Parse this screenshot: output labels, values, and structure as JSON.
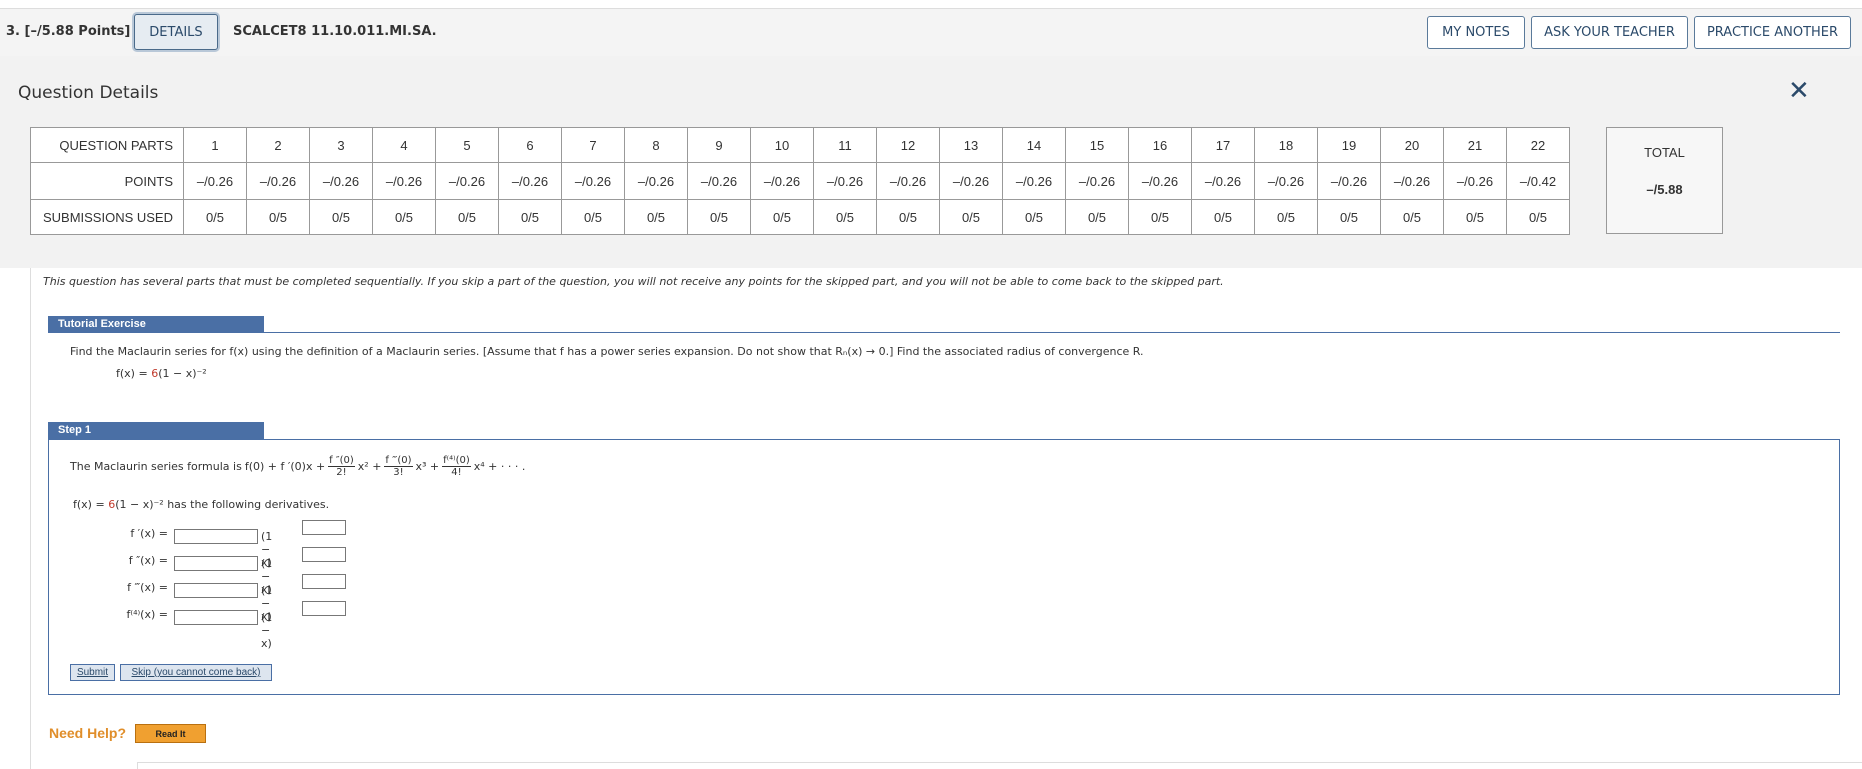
{
  "header": {
    "question_number": "3. [–/5.88 Points]",
    "details_label": "DETAILS",
    "question_code": "SCALCET8 11.10.011.MI.SA.",
    "my_notes_label": "MY NOTES",
    "ask_teacher_label": "ASK YOUR TEACHER",
    "practice_label": "PRACTICE ANOTHER"
  },
  "details": {
    "title": "Question Details",
    "close_symbol": "✕",
    "row_labels": [
      "QUESTION PARTS",
      "POINTS",
      "SUBMISSIONS USED"
    ],
    "parts": [
      "1",
      "2",
      "3",
      "4",
      "5",
      "6",
      "7",
      "8",
      "9",
      "10",
      "11",
      "12",
      "13",
      "14",
      "15",
      "16",
      "17",
      "18",
      "19",
      "20",
      "21",
      "22"
    ],
    "points": [
      "–/0.26",
      "–/0.26",
      "–/0.26",
      "–/0.26",
      "–/0.26",
      "–/0.26",
      "–/0.26",
      "–/0.26",
      "–/0.26",
      "–/0.26",
      "–/0.26",
      "–/0.26",
      "–/0.26",
      "–/0.26",
      "–/0.26",
      "–/0.26",
      "–/0.26",
      "–/0.26",
      "–/0.26",
      "–/0.26",
      "–/0.26",
      "–/0.42"
    ],
    "submissions": [
      "0/5",
      "0/5",
      "0/5",
      "0/5",
      "0/5",
      "0/5",
      "0/5",
      "0/5",
      "0/5",
      "0/5",
      "0/5",
      "0/5",
      "0/5",
      "0/5",
      "0/5",
      "0/5",
      "0/5",
      "0/5",
      "0/5",
      "0/5",
      "0/5",
      "0/5"
    ],
    "total_label": "TOTAL",
    "total_value": "–/5.88"
  },
  "content": {
    "sequential_note": "This question has several parts that must be completed sequentially. If you skip a part of the question, you will not receive any points for the skipped part, and you will not be able to come back to the skipped part.",
    "tutorial_label": "Tutorial Exercise",
    "instructions": "Find the Maclaurin series for f(x) using the definition of a Maclaurin series. [Assume that f has a power series expansion. Do not show that Rₙ(x) → 0.] Find the associated radius of convergence R.",
    "function_lhs": "f(x) = ",
    "function_coef": "6",
    "function_rhs": "(1 − x)⁻²",
    "step_label": "Step 1",
    "formula_intro": "The Maclaurin series formula is",
    "formula_start": "f(0) + f ′(0)x +",
    "formula_t2_num": "f ″(0)",
    "formula_t2_den": "2!",
    "formula_t2_x": "x² +",
    "formula_t3_num": "f ‴(0)",
    "formula_t3_den": "3!",
    "formula_t3_x": "x³ +",
    "formula_t4_num": "f⁽⁴⁾(0)",
    "formula_t4_den": "4!",
    "formula_t4_x": "x⁴ + · · · .",
    "deriv_intro_lhs": "f(x) = ",
    "deriv_intro_coef": "6",
    "deriv_intro_rhs": "(1 − x)⁻²  has the following derivatives.",
    "derivatives": [
      {
        "label": "f ′(x) =",
        "base": "(1 − x)"
      },
      {
        "label": "f ″(x) =",
        "base": "(1 − x)"
      },
      {
        "label": "f ‴(x) =",
        "base": "(1 − x)"
      },
      {
        "label": "f⁽⁴⁾(x) =",
        "base": "(1 − x)"
      }
    ],
    "submit_label": "Submit",
    "skip_label": "Skip (you cannot come back)",
    "need_help": "Need Help?",
    "read_it": "Read It"
  }
}
